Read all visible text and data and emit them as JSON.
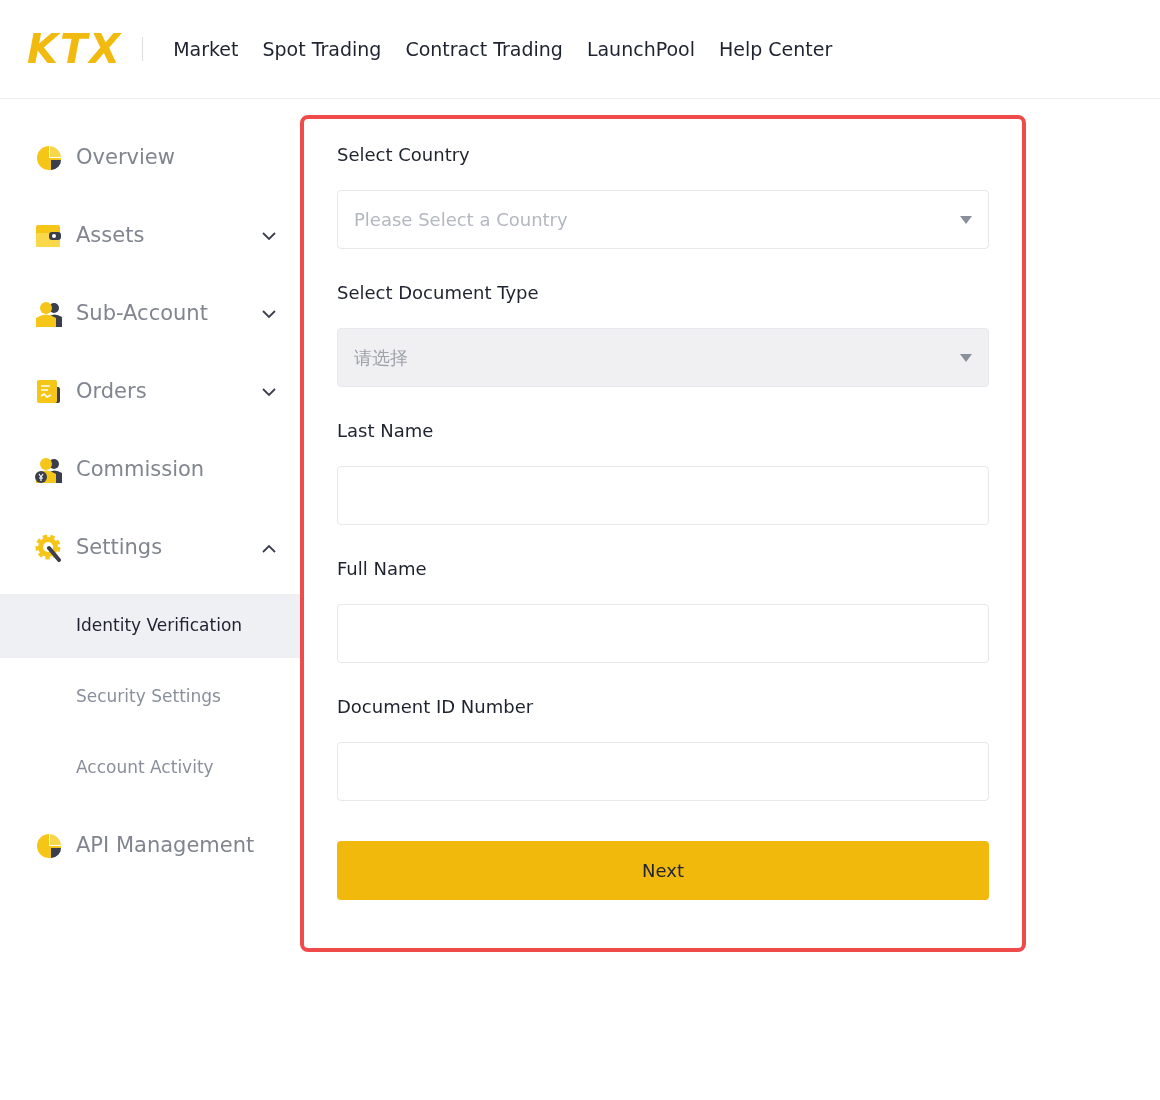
{
  "header": {
    "logo": "KTX",
    "nav": [
      "Market",
      "Spot Trading",
      "Contract Trading",
      "LaunchPool",
      "Help Center"
    ]
  },
  "sidebar": {
    "items": [
      {
        "kind": "item",
        "label": "Overview",
        "selected": false
      },
      {
        "kind": "group",
        "label": "Assets",
        "expanded": false,
        "selected": false
      },
      {
        "kind": "group",
        "label": "Sub-Account",
        "expanded": false,
        "selected": false
      },
      {
        "kind": "group",
        "label": "Orders",
        "expanded": false,
        "selected": false
      },
      {
        "kind": "item",
        "label": "Commission",
        "selected": false
      },
      {
        "kind": "group",
        "label": "Settings",
        "expanded": true,
        "selected": false
      },
      {
        "kind": "sub",
        "label": "Identity Verification",
        "selected": true
      },
      {
        "kind": "sub",
        "label": "Security Settings",
        "selected": false
      },
      {
        "kind": "sub",
        "label": "Account Activity",
        "selected": false
      },
      {
        "kind": "item",
        "label": "API Management",
        "selected": false
      }
    ]
  },
  "form": {
    "fields": [
      {
        "kind": "select",
        "label": "Select Country",
        "placeholder": "Please Select a Country",
        "disabled": false
      },
      {
        "kind": "select",
        "label": "Select Document Type",
        "placeholder": "请选择",
        "disabled": true
      },
      {
        "kind": "input",
        "label": "Last Name"
      },
      {
        "kind": "input",
        "label": "Full Name"
      },
      {
        "kind": "input",
        "label": "Document ID Number"
      }
    ],
    "submit": "Next"
  }
}
